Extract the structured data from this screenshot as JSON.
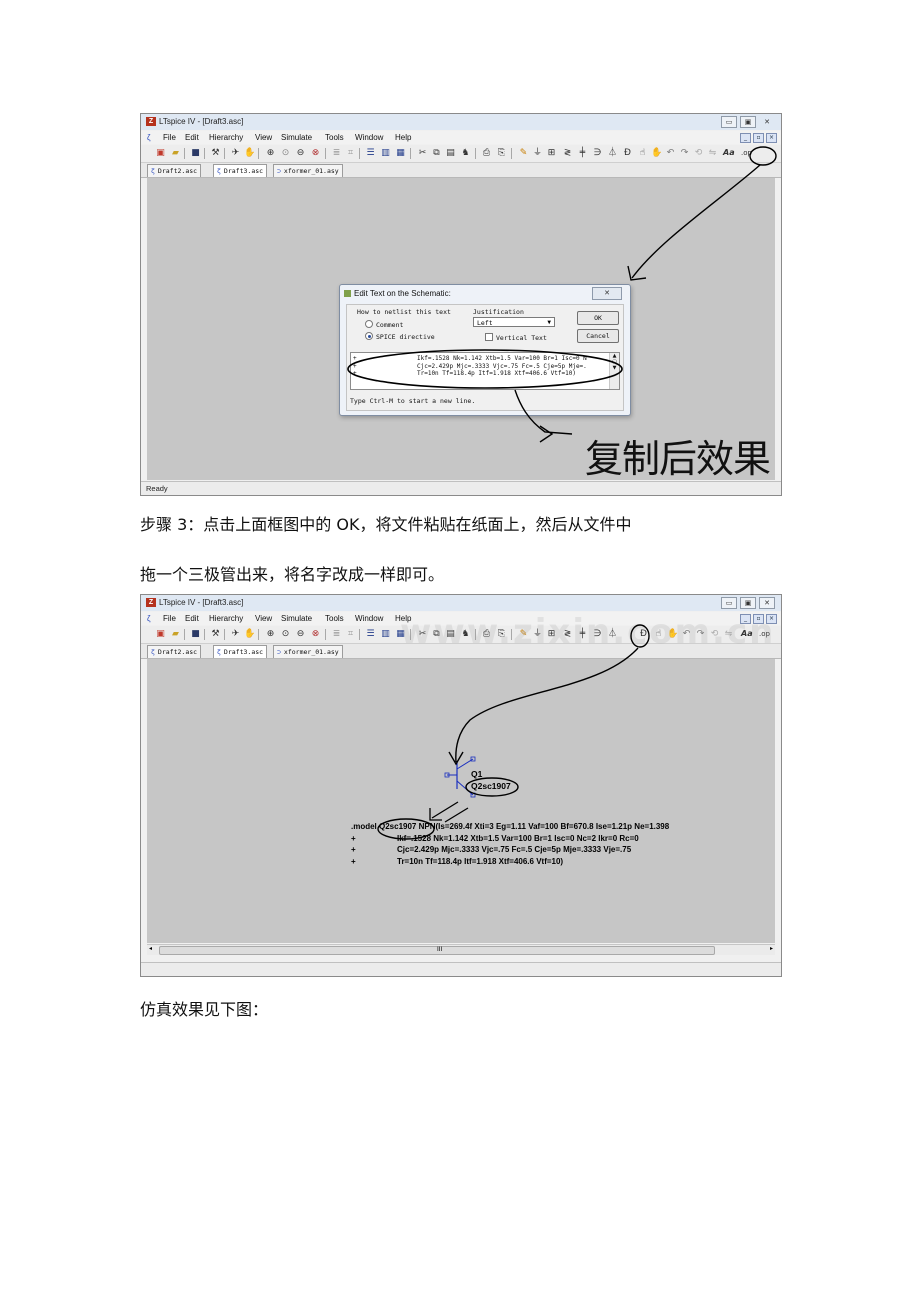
{
  "screenshot1": {
    "window_title": "LTspice IV - [Draft3.asc]",
    "app_icon": "ltspice-app-icon",
    "menus": [
      "File",
      "Edit",
      "Hierarchy",
      "View",
      "Simulate",
      "Tools",
      "Window",
      "Help"
    ],
    "tabs": [
      "Draft2.asc",
      "Draft3.asc",
      "xformer_01.asy"
    ],
    "active_tab": "Draft3.asc",
    "dialog": {
      "title": "Edit Text on the Schematic:",
      "netlist_group_label": "How to netlist this text",
      "option_comment": "Comment",
      "option_spice": "SPICE directive",
      "selected_option": "SPICE directive",
      "justification_label": "Justification",
      "justification_value": "Left",
      "vertical_text_label": "Vertical Text",
      "ok_label": "OK",
      "cancel_label": "Cancel",
      "text_lines": [
        "Ikf=.1528 Nk=1.142 Xtb=1.5 Var=100 Br=1 Isc=0 N",
        "Cjc=2.429p Mjc=.3333 Vjc=.75 Fc=.5 Cje=5p Mje=.",
        "Tr=10n Tf=118.4p Itf=1.918 Xtf=406.6 Vtf=10)"
      ],
      "line_prefix": "+",
      "hint": "Type Ctrl-M to start a new line."
    },
    "handwritten_note": "复制后效果",
    "status": "Ready"
  },
  "step3_text": {
    "line1": "步骤 3：点击上面框图中的 OK，将文件粘贴在纸面上，然后从文件中",
    "line2": "拖一个三极管出来，将名字改成一样即可。"
  },
  "screenshot2": {
    "window_title": "LTspice IV - [Draft3.asc]",
    "menus": [
      "File",
      "Edit",
      "Hierarchy",
      "View",
      "Simulate",
      "Tools",
      "Window",
      "Help"
    ],
    "tabs": [
      "Draft2.asc",
      "Draft3.asc",
      "xformer_01.asy"
    ],
    "active_tab": "Draft3.asc",
    "component_ref": "Q1",
    "component_value": "Q2sc1907",
    "model_lines": [
      ".model Q2sc1907 NPN(Is=269.4f Xti=3 Eg=1.11 Vaf=100 Bf=670.8 Ise=1.21p Ne=1.398",
      "Ikf=.1528 Nk=1.142 Xtb=1.5 Var=100 Br=1 Isc=0 Nc=2 Ikr=0 Rc=0",
      "Cjc=2.429p Mjc=.3333 Vjc=.75 Fc=.5 Cje=5p Mje=.3333 Vje=.75",
      "Tr=10n Tf=118.4p Itf=1.918 Xtf=406.6 Vtf=10)"
    ],
    "line_prefix": "+",
    "scroll_label": "III",
    "watermark": "www.zixin.com.cn"
  },
  "caption": "仿真效果见下图："
}
